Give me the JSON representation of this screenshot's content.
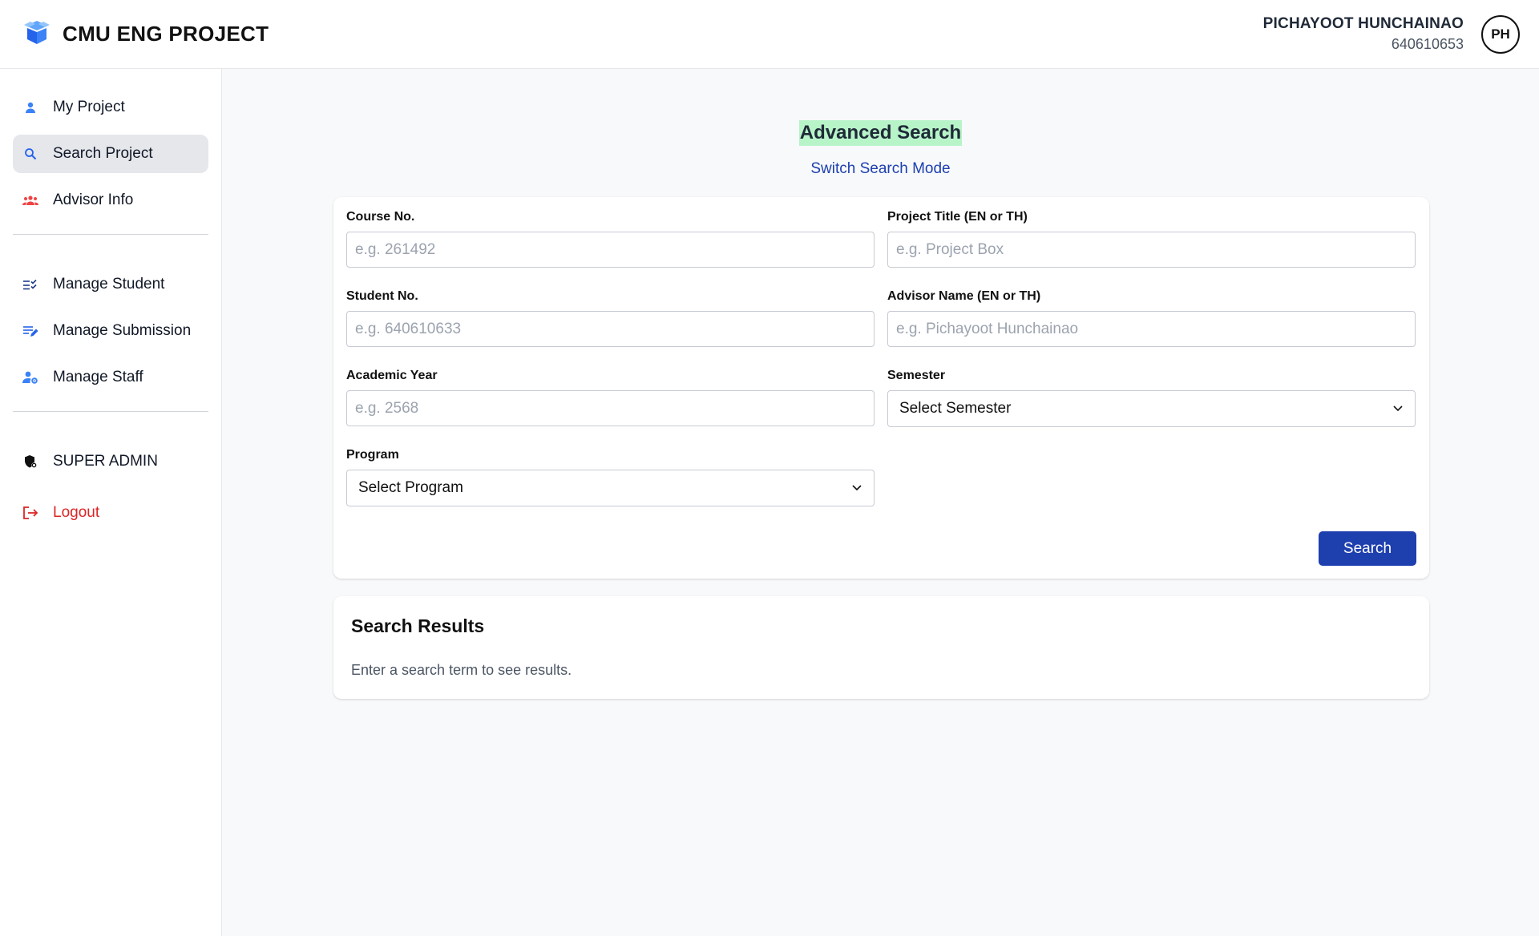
{
  "app": {
    "title": "CMU ENG PROJECT",
    "logo_icon": "open-box-icon"
  },
  "user": {
    "name": "PICHAYOOT HUNCHAINAO",
    "id": "640610653",
    "initials": "PH"
  },
  "sidebar": {
    "items": [
      {
        "label": "My Project",
        "icon": "user-icon",
        "color": "#3b82f6"
      },
      {
        "label": "Search Project",
        "icon": "search-icon",
        "color": "#2563eb",
        "active": true
      },
      {
        "label": "Advisor Info",
        "icon": "group-icon",
        "color": "#ef4444"
      }
    ],
    "manage_items": [
      {
        "label": "Manage Student",
        "icon": "checklist-icon"
      },
      {
        "label": "Manage Submission",
        "icon": "edit-list-icon"
      },
      {
        "label": "Manage Staff",
        "icon": "user-settings-icon"
      }
    ],
    "role": {
      "label": "SUPER ADMIN",
      "icon": "shield-icon"
    },
    "logout": {
      "label": "Logout",
      "icon": "logout-icon",
      "color": "#dc2626"
    }
  },
  "search": {
    "heading": "Advanced Search",
    "switch_label": "Switch Search Mode",
    "fields": {
      "course_no": {
        "label": "Course No.",
        "placeholder": "e.g. 261492"
      },
      "project_title": {
        "label": "Project Title (EN or TH)",
        "placeholder": "e.g. Project Box"
      },
      "student_no": {
        "label": "Student No.",
        "placeholder": "e.g. 640610633"
      },
      "advisor_name": {
        "label": "Advisor Name (EN or TH)",
        "placeholder": "e.g. Pichayoot Hunchainao"
      },
      "academic_year": {
        "label": "Academic Year",
        "placeholder": "e.g. 2568"
      },
      "semester": {
        "label": "Semester",
        "selected": "Select Semester"
      },
      "program": {
        "label": "Program",
        "selected": "Select Program"
      }
    },
    "button_label": "Search"
  },
  "results": {
    "title": "Search Results",
    "empty_message": "Enter a search term to see results."
  },
  "colors": {
    "accent": "#1e3fae",
    "heading_highlight": "#b7f4c8",
    "link": "#1e40af",
    "danger": "#dc2626"
  }
}
